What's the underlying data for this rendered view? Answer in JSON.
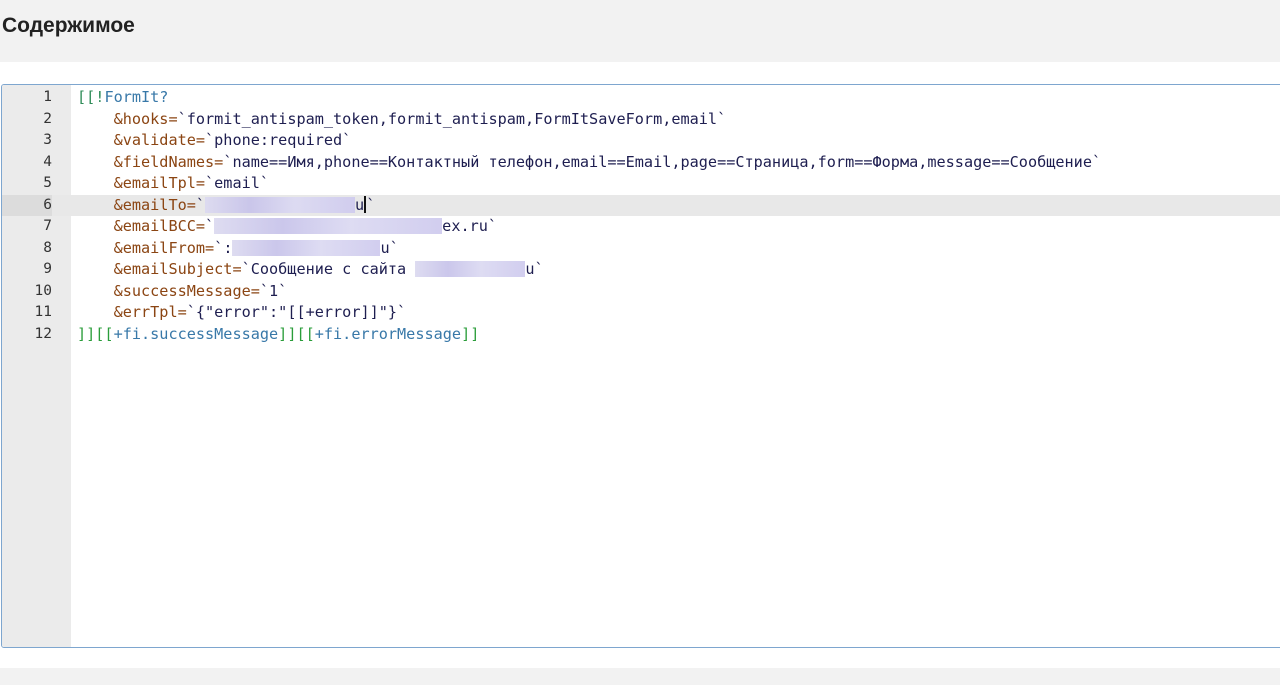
{
  "panel": {
    "title": "Содержимое"
  },
  "editor": {
    "lines": [
      {
        "n": "1",
        "parts": [
          [
            "tag",
            "[[!"
          ],
          [
            "name",
            "FormIt?"
          ]
        ]
      },
      {
        "n": "2",
        "parts": [
          [
            "sp",
            "    "
          ],
          [
            "prop",
            "&hooks="
          ],
          [
            "str",
            "`formit_antispam_token,formit_antispam,FormItSaveForm,email`"
          ]
        ]
      },
      {
        "n": "3",
        "parts": [
          [
            "sp",
            "    "
          ],
          [
            "prop",
            "&validate="
          ],
          [
            "str",
            "`phone:required`"
          ]
        ]
      },
      {
        "n": "4",
        "parts": [
          [
            "sp",
            "    "
          ],
          [
            "prop",
            "&fieldNames="
          ],
          [
            "str",
            "`name==Имя,phone==Контактный телефон,email==Email,page==Страница,form==Форма,message==Сообщение`"
          ]
        ]
      },
      {
        "n": "5",
        "parts": [
          [
            "sp",
            "    "
          ],
          [
            "prop",
            "&emailTpl="
          ],
          [
            "str",
            "`email`"
          ]
        ]
      },
      {
        "n": "6",
        "parts": [
          [
            "sp",
            "    "
          ],
          [
            "prop",
            "&emailTo="
          ],
          [
            "str",
            "`"
          ],
          [
            "redact",
            "150"
          ],
          [
            "str",
            "u"
          ],
          [
            "cursor",
            ""
          ],
          [
            "str",
            "`"
          ]
        ]
      },
      {
        "n": "7",
        "parts": [
          [
            "sp",
            "    "
          ],
          [
            "prop",
            "&emailBCC="
          ],
          [
            "str",
            "`"
          ],
          [
            "redact",
            "228"
          ],
          [
            "str",
            "ex.ru`"
          ]
        ]
      },
      {
        "n": "8",
        "parts": [
          [
            "sp",
            "    "
          ],
          [
            "prop",
            "&emailFrom="
          ],
          [
            "str",
            "`:"
          ],
          [
            "redact",
            "148"
          ],
          [
            "str",
            "u`"
          ]
        ]
      },
      {
        "n": "9",
        "parts": [
          [
            "sp",
            "    "
          ],
          [
            "prop",
            "&emailSubject="
          ],
          [
            "str",
            "`Сообщение с сайта "
          ],
          [
            "redact",
            "110"
          ],
          [
            "str",
            "u`"
          ]
        ]
      },
      {
        "n": "10",
        "parts": [
          [
            "sp",
            "    "
          ],
          [
            "prop",
            "&successMessage="
          ],
          [
            "str",
            "`1`"
          ]
        ]
      },
      {
        "n": "11",
        "parts": [
          [
            "sp",
            "    "
          ],
          [
            "prop",
            "&errTpl="
          ],
          [
            "str",
            "`{\"error\":\"[[+error]]\"}`"
          ]
        ]
      },
      {
        "n": "12",
        "parts": [
          [
            "brack",
            "]][["
          ],
          [
            "ph",
            "+fi.successMessage"
          ],
          [
            "brack",
            "]][["
          ],
          [
            "ph",
            "+fi.errorMessage"
          ],
          [
            "brack",
            "]]"
          ]
        ]
      }
    ],
    "active_line": "6"
  }
}
